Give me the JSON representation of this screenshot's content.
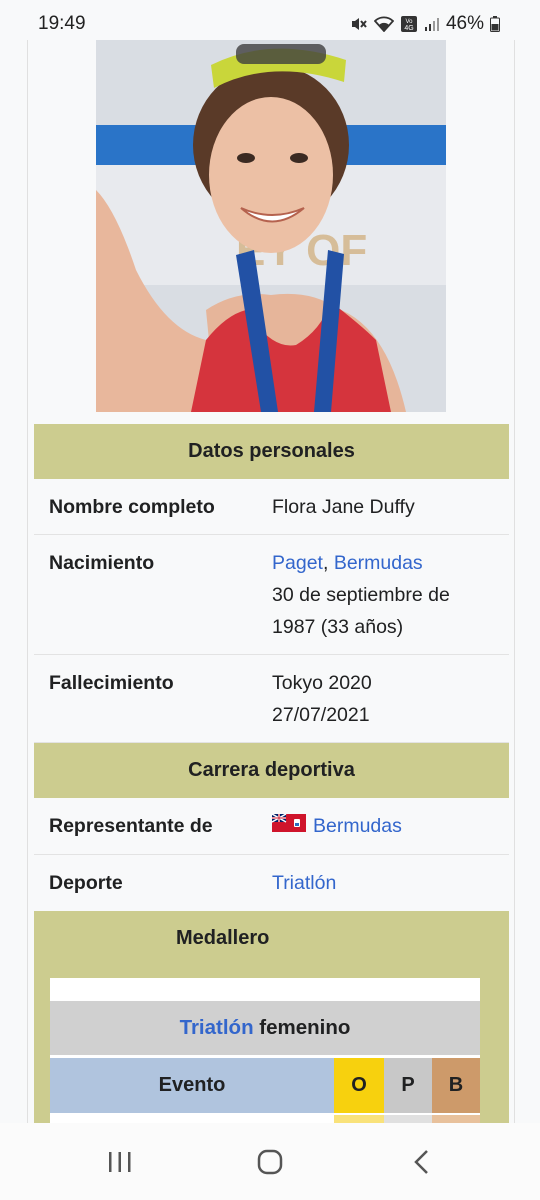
{
  "status_bar": {
    "time": "19:49",
    "battery_percent": "46%",
    "network_label": "Vo 4G"
  },
  "infobox": {
    "personal_header": "Datos personales",
    "rows": [
      {
        "label": "Nombre completo",
        "value": "Flora Jane Duffy"
      },
      {
        "label": "Nacimiento",
        "place_city": "Paget",
        "place_sep": ", ",
        "place_country": "Bermudas",
        "date": "30 de septiembre de",
        "date2": "1987 (33 años)"
      },
      {
        "label": "Fallecimiento",
        "value1": "Tokyo 2020",
        "value2": "27/07/2021"
      }
    ],
    "career_header": "Carrera deportiva",
    "career_rows": [
      {
        "label": "Representante de",
        "value": "Bermudas",
        "flag_icon": "bermuda-flag-icon"
      },
      {
        "label": "Deporte",
        "value": "Triatlón"
      }
    ],
    "medal_header": "Medallero",
    "medal_category_link": "Triatlón",
    "medal_category_rest": " femenino",
    "medal_columns": {
      "event": "Evento",
      "gold": "O",
      "silver": "P",
      "bronze": "B"
    }
  },
  "colors": {
    "section_bg": "#cccc8f",
    "link": "#3366cc",
    "gold": "#f7d10e",
    "silver": "#c8c8c8",
    "bronze": "#cd9a6a",
    "event_header": "#b0c4de"
  },
  "nav_bar": {
    "recents_icon": "recents-icon",
    "home_icon": "home-icon",
    "back_icon": "back-icon"
  }
}
